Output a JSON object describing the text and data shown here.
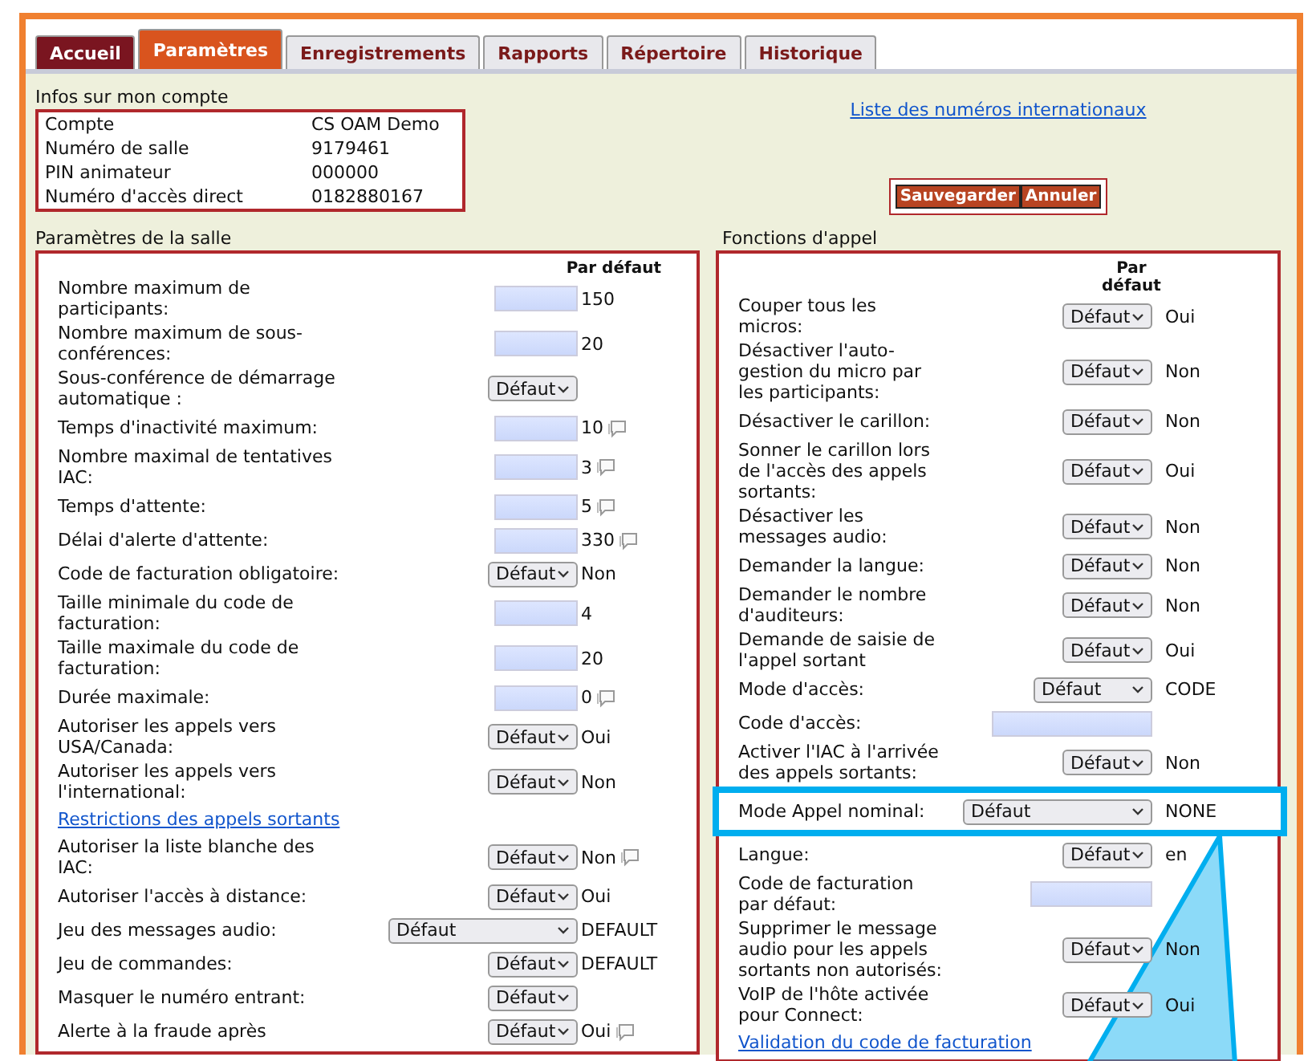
{
  "tabs": [
    {
      "label": "Accueil",
      "kind": "home",
      "selected": false
    },
    {
      "label": "Paramètres",
      "kind": "plain",
      "selected": true
    },
    {
      "label": "Enregistrements",
      "kind": "plain",
      "selected": false
    },
    {
      "label": "Rapports",
      "kind": "plain",
      "selected": false
    },
    {
      "label": "Répertoire",
      "kind": "plain",
      "selected": false
    },
    {
      "label": "Historique",
      "kind": "plain",
      "selected": false
    }
  ],
  "account": {
    "title": "Infos sur mon compte",
    "rows": [
      {
        "label": "Compte",
        "value": "CS OAM Demo"
      },
      {
        "label": "Numéro de salle",
        "value": "9179461"
      },
      {
        "label": "PIN animateur",
        "value": "000000"
      },
      {
        "label": "Numéro d'accès direct",
        "value": "0182880167"
      }
    ]
  },
  "international_link": "Liste des numéros internationaux",
  "buttons": [
    "Sauvegarder",
    "Annuler"
  ],
  "room": {
    "title": "Paramètres de la salle",
    "default_header": "Par défaut",
    "rows": [
      {
        "kind": "input",
        "label": "Nombre maximum de participants:",
        "default": "150",
        "note": false
      },
      {
        "kind": "input",
        "label": "Nombre maximum de sous-conférences:",
        "default": "20",
        "note": false
      },
      {
        "kind": "select",
        "label": "Sous-conférence de démarrage automatique :",
        "value": "Défaut",
        "note": false
      },
      {
        "kind": "input",
        "label": "Temps d'inactivité maximum:",
        "default": "10",
        "note": true
      },
      {
        "kind": "input",
        "label": "Nombre maximal de tentatives IAC:",
        "default": "3",
        "note": true
      },
      {
        "kind": "input",
        "label": "Temps d'attente:",
        "default": "5",
        "note": true
      },
      {
        "kind": "input",
        "label": "Délai d'alerte d'attente:",
        "default": "330",
        "note": true
      },
      {
        "kind": "select",
        "label": "Code de facturation obligatoire:",
        "value": "Défaut",
        "default": "Non",
        "note": false
      },
      {
        "kind": "input",
        "label": "Taille minimale du code de facturation:",
        "default": "4",
        "note": false
      },
      {
        "kind": "input",
        "label": "Taille maximale du code de facturation:",
        "default": "20",
        "note": false
      },
      {
        "kind": "input",
        "label": "Durée maximale:",
        "default": "0",
        "note": true
      },
      {
        "kind": "select",
        "label": "Autoriser les appels vers USA/Canada:",
        "value": "Défaut",
        "default": "Oui",
        "note": false
      },
      {
        "kind": "select",
        "label": "Autoriser les appels vers l'international:",
        "value": "Défaut",
        "default": "Non",
        "note": false
      },
      {
        "kind": "link",
        "label": "Restrictions des appels sortants"
      },
      {
        "kind": "select",
        "label": "Autoriser la liste blanche des IAC:",
        "value": "Défaut",
        "default": "Non",
        "note": true
      },
      {
        "kind": "select",
        "label": "Autoriser l'accès à distance:",
        "value": "Défaut",
        "default": "Oui",
        "note": false
      },
      {
        "kind": "select_large",
        "label": "Jeu des messages audio:",
        "value": "Défaut",
        "default": "DEFAULT",
        "note": false
      },
      {
        "kind": "select",
        "label": "Jeu de commandes:",
        "value": "Défaut",
        "default": "DEFAULT",
        "note": false
      },
      {
        "kind": "select",
        "label": "Masquer le numéro entrant:",
        "value": "Défaut",
        "note": false
      },
      {
        "kind": "select",
        "label": "Alerte à la fraude après",
        "value": "Défaut",
        "default": "Oui",
        "note": true
      }
    ]
  },
  "calls": {
    "title": "Fonctions d'appel",
    "default_header": "Par défaut",
    "rows": [
      {
        "kind": "select",
        "label": "Couper tous les micros:",
        "value": "Défaut",
        "default": "Oui",
        "highlighted": false
      },
      {
        "kind": "select",
        "label": "Désactiver l'auto-gestion du micro par les participants:",
        "value": "Défaut",
        "default": "Non",
        "highlighted": false
      },
      {
        "kind": "select",
        "label": "Désactiver le carillon:",
        "value": "Défaut",
        "default": "Non",
        "highlighted": false
      },
      {
        "kind": "select",
        "label": "Sonner le carillon lors de l'accès des appels sortants:",
        "value": "Défaut",
        "default": "Oui",
        "highlighted": false
      },
      {
        "kind": "select",
        "label": "Désactiver les messages audio:",
        "value": "Défaut",
        "default": "Non",
        "highlighted": false
      },
      {
        "kind": "select",
        "label": "Demander la langue:",
        "value": "Défaut",
        "default": "Non",
        "highlighted": false
      },
      {
        "kind": "select",
        "label": "Demander le nombre d'auditeurs:",
        "value": "Défaut",
        "default": "Non",
        "highlighted": false
      },
      {
        "kind": "select",
        "label": "Demande de saisie de l'appel sortant",
        "value": "Défaut",
        "default": "Oui",
        "highlighted": false
      },
      {
        "kind": "select_medium",
        "label": "Mode d'accès:",
        "value": "Défaut",
        "default": "CODE",
        "highlighted": false
      },
      {
        "kind": "input_large",
        "label": "Code d'accès:",
        "highlighted": false
      },
      {
        "kind": "select",
        "label": "Activer l'IAC à l'arrivée des appels sortants:",
        "value": "Défaut",
        "default": "Non",
        "highlighted": false
      },
      {
        "kind": "select_large",
        "label": "Mode Appel nominal:",
        "value": "Défaut",
        "default": "NONE",
        "highlighted": true
      },
      {
        "kind": "select",
        "label": "Langue:",
        "value": "Défaut",
        "default": "en",
        "highlighted": false
      },
      {
        "kind": "input_medium",
        "label": "Code de facturation par défaut:",
        "highlighted": false
      },
      {
        "kind": "select",
        "label": "Supprimer le message audio pour les appels sortants non autorisés:",
        "value": "Défaut",
        "default": "Non",
        "highlighted": false
      },
      {
        "kind": "select",
        "label": "VoIP de l'hôte activée pour Connect:",
        "value": "Défaut",
        "default": "Oui",
        "highlighted": false
      },
      {
        "kind": "link",
        "label": "Validation du code de facturation"
      }
    ]
  }
}
